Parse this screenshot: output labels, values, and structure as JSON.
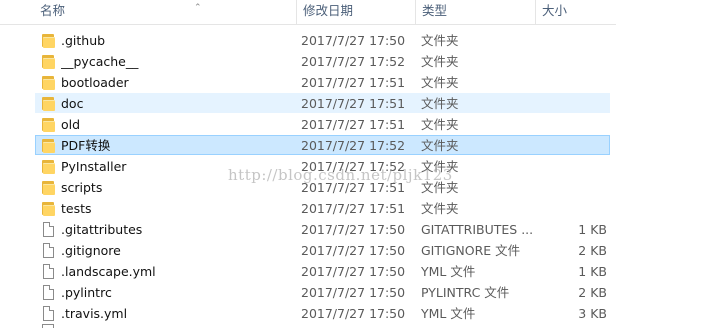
{
  "columns": {
    "name": "名称",
    "date": "修改日期",
    "type": "类型",
    "size": "大小"
  },
  "rows": [
    {
      "name": ".github",
      "date": "2017/7/27 17:50",
      "type": "文件夹",
      "size": "",
      "icon": "folder-icon",
      "state": "normal"
    },
    {
      "name": "__pycache__",
      "date": "2017/7/27 17:52",
      "type": "文件夹",
      "size": "",
      "icon": "folder-icon",
      "state": "normal"
    },
    {
      "name": "bootloader",
      "date": "2017/7/27 17:51",
      "type": "文件夹",
      "size": "",
      "icon": "folder-icon",
      "state": "normal"
    },
    {
      "name": "doc",
      "date": "2017/7/27 17:51",
      "type": "文件夹",
      "size": "",
      "icon": "folder-icon",
      "state": "hover"
    },
    {
      "name": "old",
      "date": "2017/7/27 17:51",
      "type": "文件夹",
      "size": "",
      "icon": "folder-icon",
      "state": "normal"
    },
    {
      "name": "PDF转换",
      "date": "2017/7/27 17:52",
      "type": "文件夹",
      "size": "",
      "icon": "folder-icon",
      "state": "selected"
    },
    {
      "name": "PyInstaller",
      "date": "2017/7/27 17:52",
      "type": "文件夹",
      "size": "",
      "icon": "folder-icon",
      "state": "normal"
    },
    {
      "name": "scripts",
      "date": "2017/7/27 17:51",
      "type": "文件夹",
      "size": "",
      "icon": "folder-icon",
      "state": "normal"
    },
    {
      "name": "tests",
      "date": "2017/7/27 17:51",
      "type": "文件夹",
      "size": "",
      "icon": "folder-icon",
      "state": "normal"
    },
    {
      "name": ".gitattributes",
      "date": "2017/7/27 17:50",
      "type": "GITATTRIBUTES ...",
      "size": "1 KB",
      "icon": "file-icon",
      "state": "normal"
    },
    {
      "name": ".gitignore",
      "date": "2017/7/27 17:50",
      "type": "GITIGNORE 文件",
      "size": "2 KB",
      "icon": "file-icon",
      "state": "normal"
    },
    {
      "name": ".landscape.yml",
      "date": "2017/7/27 17:50",
      "type": "YML 文件",
      "size": "1 KB",
      "icon": "file-icon",
      "state": "normal"
    },
    {
      "name": ".pylintrc",
      "date": "2017/7/27 17:50",
      "type": "PYLINTRC 文件",
      "size": "2 KB",
      "icon": "file-icon",
      "state": "normal"
    },
    {
      "name": ".travis.yml",
      "date": "2017/7/27 17:50",
      "type": "YML 文件",
      "size": "3 KB",
      "icon": "file-icon",
      "state": "normal"
    }
  ],
  "watermark": "http://blog.csdn.net/pljk123"
}
